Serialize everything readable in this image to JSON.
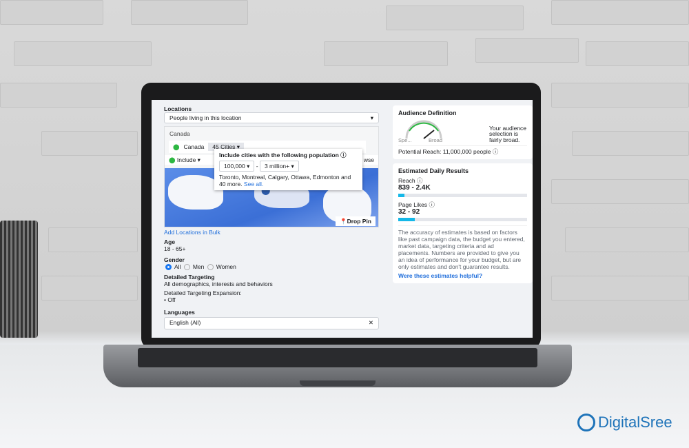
{
  "locations": {
    "label": "Locations",
    "type_select": "People living in this location",
    "country_header": "Canada",
    "country_chip": "Canada",
    "cities_dropdown": "45 Cities",
    "include_dropdown": "Include",
    "browse": "wse",
    "drop_pin": "Drop Pin",
    "add_bulk": "Add Locations in Bulk",
    "popup": {
      "title": "Include cities with the following population",
      "min": "100,000",
      "dash": "-",
      "max": "3 million+",
      "cities": "Toronto, Montreal, Calgary, Ottawa, Edmonton and 40 more.",
      "see_all": "See all."
    }
  },
  "age": {
    "label": "Age",
    "value": "18 - 65+"
  },
  "gender": {
    "label": "Gender",
    "options": [
      "All",
      "Men",
      "Women"
    ],
    "selected": "All"
  },
  "detailed": {
    "label": "Detailed Targeting",
    "value": "All demographics, interests and behaviors",
    "expansion_label": "Detailed Targeting Expansion:",
    "expansion_value": "Off"
  },
  "languages": {
    "label": "Languages",
    "value": "English (All)"
  },
  "audience": {
    "title": "Audience Definition",
    "gauge_left": "Spe...",
    "gauge_right": "Broad",
    "note": "Your audience selection is fairly broad.",
    "potential_reach": "Potential Reach: 11,000,000 people"
  },
  "estimates": {
    "title": "Estimated Daily Results",
    "reach_label": "Reach",
    "reach_value": "839 - 2.4K",
    "reach_fill_pct": 5,
    "likes_label": "Page Likes",
    "likes_value": "32 - 92",
    "likes_fill_pct": 13,
    "disclaimer": "The accuracy of estimates is based on factors like past campaign data, the budget you entered, market data, targeting criteria and ad placements. Numbers are provided to give you an idea of performance for your budget, but are only estimates and don't guarantee results.",
    "helpful_link": "Were these estimates helpful?"
  },
  "brand": {
    "logo_text": "DigitalSree",
    "color": "#1e73b9"
  },
  "colors": {
    "accent": "#1877f2",
    "bar": "#15b8e8",
    "include_green": "#2db742"
  }
}
